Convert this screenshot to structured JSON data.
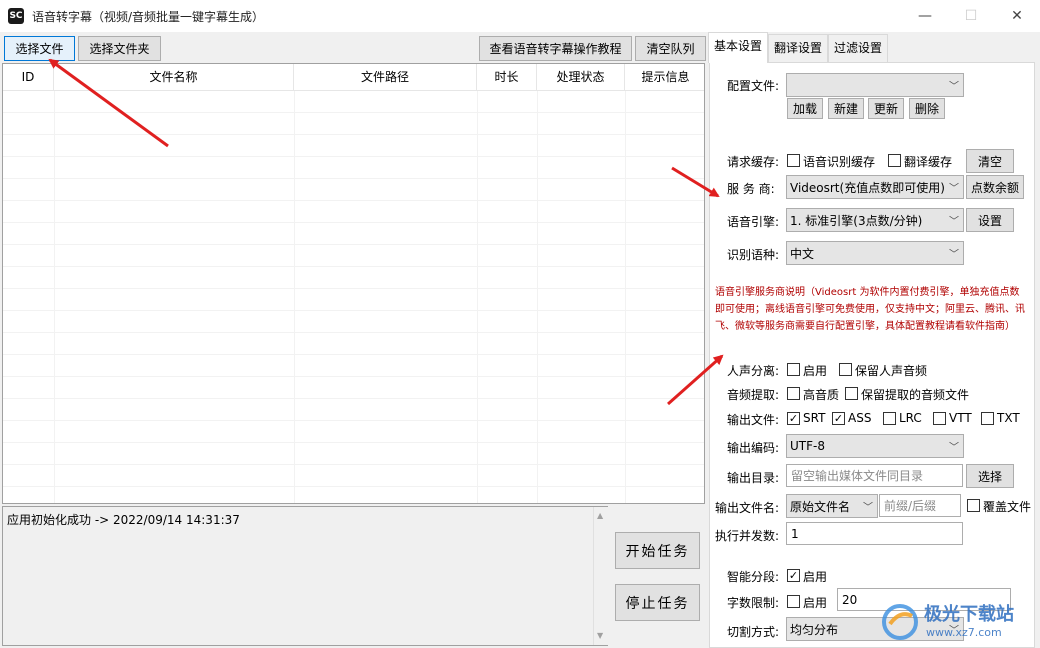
{
  "window": {
    "title": "语音转字幕（视频/音频批量一键字幕生成）",
    "app_icon": "app-logo",
    "min_icon": "—",
    "max_icon": "☐",
    "close_icon": "✕"
  },
  "toolbar": {
    "select_file": "选择文件",
    "select_folder": "选择文件夹",
    "tutorial": "查看语音转字幕操作教程",
    "clear_queue": "清空队列"
  },
  "table": {
    "columns": [
      "ID",
      "文件名称",
      "文件路径",
      "时长",
      "处理状态",
      "提示信息"
    ]
  },
  "log": {
    "text": "应用初始化成功  ->  2022/09/14 14:31:37"
  },
  "actions": {
    "start": "开始任务",
    "stop": "停止任务"
  },
  "tabs": [
    "基本设置",
    "翻译设置",
    "过滤设置"
  ],
  "settings": {
    "config_label": "配置文件:",
    "config_value": "",
    "load": "加载",
    "new": "新建",
    "update": "更新",
    "delete": "删除",
    "cache_label": "请求缓存:",
    "cache_asr": "语音识别缓存",
    "cache_translate": "翻译缓存",
    "cache_clear": "清空",
    "provider_label": "服 务 商:",
    "provider_value": "Videosrt(充值点数即可使用)",
    "balance": "点数余额",
    "engine_label": "语音引擎:",
    "engine_value": "1. 标准引擎(3点数/分钟)",
    "engine_settings": "设置",
    "lang_label": "识别语种:",
    "lang_value": "中文",
    "notice": "语音引擎服务商说明（Videosrt 为软件内置付费引擎，单独充值点数即可使用；离线语音引擎可免费使用，仅支持中文；阿里云、腾讯、讯飞、微软等服务商需要自行配置引擎，具体配置教程请看软件指南）",
    "vocal_label": "人声分离:",
    "vocal_enable": "启用",
    "vocal_keep": "保留人声音频",
    "audio_label": "音频提取:",
    "audio_hq": "高音质",
    "audio_keep": "保留提取的音频文件",
    "output_files_label": "输出文件:",
    "fmt_srt": "SRT",
    "fmt_ass": "ASS",
    "fmt_lrc": "LRC",
    "fmt_vtt": "VTT",
    "fmt_txt": "TXT",
    "encoding_label": "输出编码:",
    "encoding_value": "UTF-8",
    "outdir_label": "输出目录:",
    "outdir_placeholder": "留空输出媒体文件同目录",
    "outdir_choose": "选择",
    "outname_label": "输出文件名:",
    "outname_value": "原始文件名",
    "outname_placeholder": "前缀/后缀",
    "overwrite": "覆盖文件",
    "concurrency_label": "执行并发数:",
    "concurrency_value": "1",
    "smart_label": "智能分段:",
    "smart_enable": "启用",
    "charlimit_label": "字数限制:",
    "charlimit_enable": "启用",
    "charlimit_value": "20",
    "split_label": "切割方式:",
    "split_value": "均匀分布"
  },
  "checks": {
    "cache_asr": false,
    "cache_translate": false,
    "vocal_enable": false,
    "vocal_keep": false,
    "audio_hq": false,
    "audio_keep": false,
    "fmt_srt": true,
    "fmt_ass": true,
    "fmt_lrc": false,
    "fmt_vtt": false,
    "fmt_txt": false,
    "overwrite": false,
    "smart_enable": true,
    "charlimit_enable": false
  },
  "watermark": {
    "brand": "极光下载站",
    "url": "www.xz7.com"
  },
  "colors": {
    "arrow": "#e02020",
    "notice": "#b00000",
    "focus": "#0078d7"
  }
}
